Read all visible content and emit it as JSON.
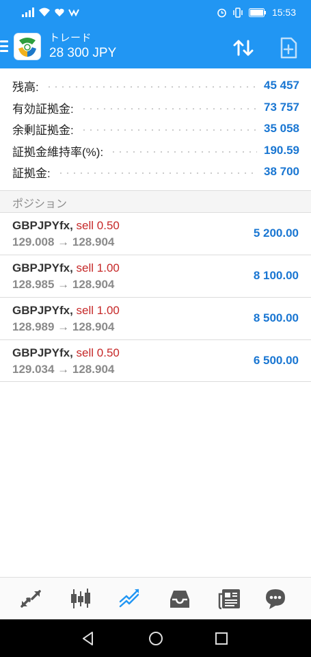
{
  "status_bar": {
    "time": "15:53"
  },
  "toolbar": {
    "title": "トレード",
    "balance": "28 300 JPY"
  },
  "summary": [
    {
      "label": "残高:",
      "value": "45 457"
    },
    {
      "label": "有効証拠金:",
      "value": "73 757"
    },
    {
      "label": "余剰証拠金:",
      "value": "35 058"
    },
    {
      "label": "証拠金維持率(%):",
      "value": "190.59"
    },
    {
      "label": "証拠金:",
      "value": "38 700"
    }
  ],
  "positions_header": "ポジション",
  "positions": [
    {
      "symbol": "GBPJPYfx,",
      "direction": "sell 0.50",
      "prices": "129.008 → 128.904",
      "profit": "5 200.00"
    },
    {
      "symbol": "GBPJPYfx,",
      "direction": "sell 1.00",
      "prices": "128.985 → 128.904",
      "profit": "8 100.00"
    },
    {
      "symbol": "GBPJPYfx,",
      "direction": "sell 1.00",
      "prices": "128.989 → 128.904",
      "profit": "8 500.00"
    },
    {
      "symbol": "GBPJPYfx,",
      "direction": "sell 0.50",
      "prices": "129.034 → 128.904",
      "profit": "6 500.00"
    }
  ],
  "colors": {
    "accent": "#2196f3",
    "value_blue": "#1976d2",
    "sell_red": "#c62828"
  },
  "bottom_nav": [
    "quotes-icon",
    "chart-icon",
    "trade-icon",
    "history-icon",
    "news-icon",
    "chat-icon"
  ]
}
